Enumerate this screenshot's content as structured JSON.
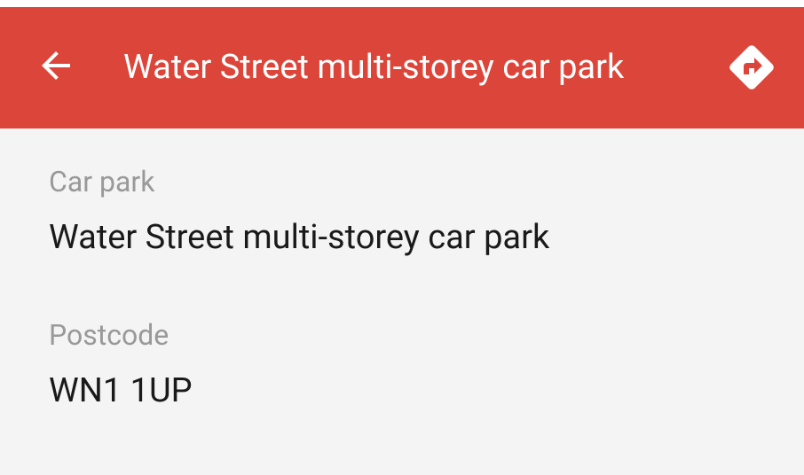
{
  "app_bar": {
    "title": "Water Street multi-storey car park",
    "back_icon": "arrow-back-icon",
    "directions_icon": "directions-icon",
    "color": "#dc4539"
  },
  "details": {
    "car_park_label": "Car park",
    "car_park_value": "Water Street multi-storey car park",
    "postcode_label": "Postcode",
    "postcode_value": "WN1 1UP"
  }
}
